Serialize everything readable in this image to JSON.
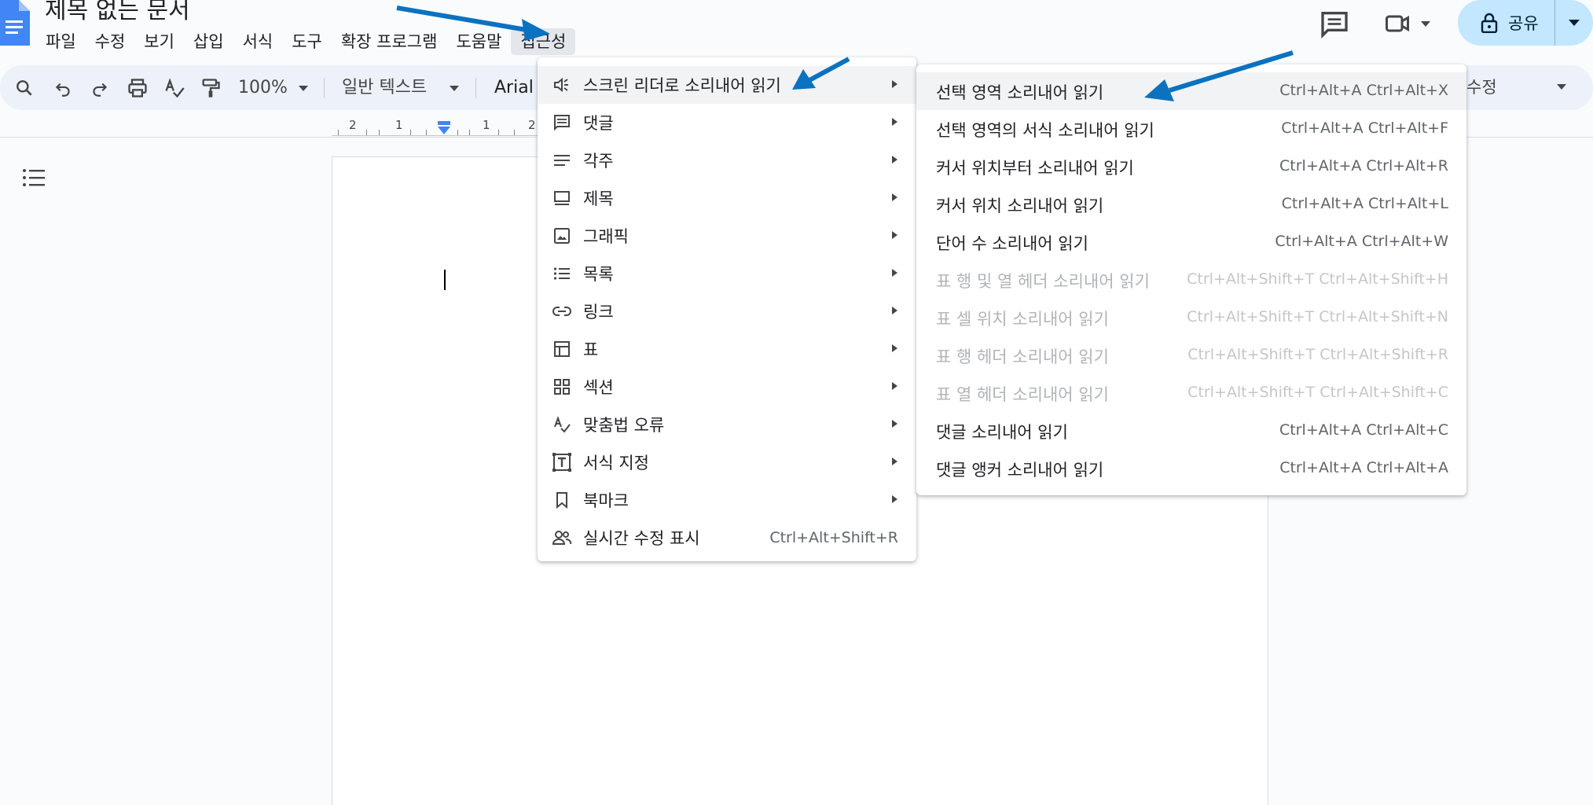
{
  "document": {
    "title": "제목 없는 문서"
  },
  "menubar": {
    "items": [
      "파일",
      "수정",
      "보기",
      "삽입",
      "서식",
      "도구",
      "확장 프로그램",
      "도움말",
      "접근성"
    ]
  },
  "header": {
    "share_label": "공유"
  },
  "toolbar": {
    "zoom": "100%",
    "style": "일반 텍스트",
    "font": "Arial",
    "right_partial_text": "수정"
  },
  "ruler": {
    "labels": [
      "2",
      "1",
      "1",
      "2"
    ]
  },
  "accessibility_menu": {
    "items": [
      {
        "label": "스크린 리더로 소리내어 읽기",
        "icon": "speaker-icon",
        "submenu": true
      },
      {
        "label": "댓글",
        "icon": "comment-icon",
        "submenu": true
      },
      {
        "label": "각주",
        "icon": "footnote-icon",
        "submenu": true
      },
      {
        "label": "제목",
        "icon": "heading-icon",
        "submenu": true
      },
      {
        "label": "그래픽",
        "icon": "image-icon",
        "submenu": true
      },
      {
        "label": "목록",
        "icon": "list-icon",
        "submenu": true
      },
      {
        "label": "링크",
        "icon": "link-icon",
        "submenu": true
      },
      {
        "label": "표",
        "icon": "table-icon",
        "submenu": true
      },
      {
        "label": "섹션",
        "icon": "section-icon",
        "submenu": true
      },
      {
        "label": "맞춤법 오류",
        "icon": "spellcheck-icon",
        "submenu": true
      },
      {
        "label": "서식 지정",
        "icon": "format-text-icon",
        "submenu": true
      },
      {
        "label": "북마크",
        "icon": "bookmark-icon",
        "submenu": true
      },
      {
        "label": "실시간 수정 표시",
        "icon": "people-icon",
        "submenu": false,
        "shortcut": "Ctrl+Alt+Shift+R"
      }
    ]
  },
  "screen_reader_submenu": {
    "items": [
      {
        "label": "선택 영역 소리내어 읽기",
        "shortcut": "Ctrl+Alt+A Ctrl+Alt+X",
        "enabled": true
      },
      {
        "label": "선택 영역의 서식 소리내어 읽기",
        "shortcut": "Ctrl+Alt+A Ctrl+Alt+F",
        "enabled": true
      },
      {
        "label": "커서 위치부터 소리내어 읽기",
        "shortcut": "Ctrl+Alt+A Ctrl+Alt+R",
        "enabled": true
      },
      {
        "label": "커서 위치 소리내어 읽기",
        "shortcut": "Ctrl+Alt+A Ctrl+Alt+L",
        "enabled": true
      },
      {
        "label": "단어 수 소리내어 읽기",
        "shortcut": "Ctrl+Alt+A Ctrl+Alt+W",
        "enabled": true
      },
      {
        "label": "표 행 및 열 헤더 소리내어 읽기",
        "shortcut": "Ctrl+Alt+Shift+T Ctrl+Alt+Shift+H",
        "enabled": false
      },
      {
        "label": "표 셀 위치 소리내어 읽기",
        "shortcut": "Ctrl+Alt+Shift+T Ctrl+Alt+Shift+N",
        "enabled": false
      },
      {
        "label": "표 행 헤더 소리내어 읽기",
        "shortcut": "Ctrl+Alt+Shift+T Ctrl+Alt+Shift+R",
        "enabled": false
      },
      {
        "label": "표 열 헤더 소리내어 읽기",
        "shortcut": "Ctrl+Alt+Shift+T Ctrl+Alt+Shift+C",
        "enabled": false
      },
      {
        "label": "댓글 소리내어 읽기",
        "shortcut": "Ctrl+Alt+A Ctrl+Alt+C",
        "enabled": true
      },
      {
        "label": "댓글 앵커 소리내어 읽기",
        "shortcut": "Ctrl+Alt+A Ctrl+Alt+A",
        "enabled": true
      }
    ]
  },
  "colors": {
    "accent": "#0b72c0",
    "share_bg": "#c2e7ff",
    "toolbar_bg": "#edf2fa"
  }
}
